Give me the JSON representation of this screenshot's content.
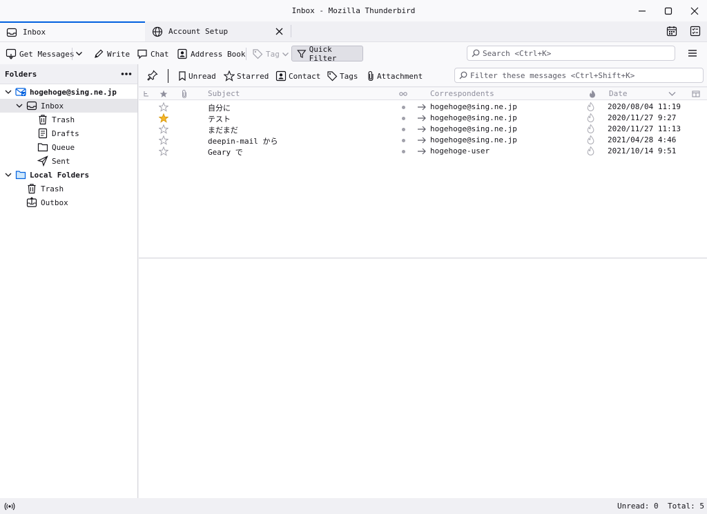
{
  "window": {
    "title": "Inbox - Mozilla Thunderbird"
  },
  "tabs": [
    {
      "label": "Inbox"
    },
    {
      "label": "Account Setup"
    }
  ],
  "toolbar": {
    "get_messages": "Get Messages",
    "write": "Write",
    "chat": "Chat",
    "address_book": "Address Book",
    "tag": "Tag",
    "quick_filter": "Quick Filter",
    "search_placeholder": "Search <Ctrl+K>"
  },
  "folders": {
    "header": "Folders",
    "account": "hogehoge@sing.ne.jp",
    "items": [
      "Inbox",
      "Trash",
      "Drafts",
      "Queue",
      "Sent"
    ],
    "local_folders": "Local Folders",
    "local_items": [
      "Trash",
      "Outbox"
    ]
  },
  "quickfilter": {
    "unread": "Unread",
    "starred": "Starred",
    "contact": "Contact",
    "tags": "Tags",
    "attachment": "Attachment",
    "filter_placeholder": "Filter these messages <Ctrl+Shift+K>"
  },
  "columns": {
    "subject": "Subject",
    "correspondents": "Correspondents",
    "date": "Date"
  },
  "messages": [
    {
      "subject": "自分に",
      "correspondent": "hogehoge@sing.ne.jp",
      "date": "2020/08/04 11:19",
      "starred": false
    },
    {
      "subject": "テスト",
      "correspondent": "hogehoge@sing.ne.jp",
      "date": "2020/11/27 9:27",
      "starred": true
    },
    {
      "subject": "まだまだ",
      "correspondent": "hogehoge@sing.ne.jp",
      "date": "2020/11/27 11:13",
      "starred": false
    },
    {
      "subject": "deepin-mail から",
      "correspondent": "hogehoge@sing.ne.jp",
      "date": "2021/04/28 4:46",
      "starred": false
    },
    {
      "subject": "Geary で",
      "correspondent": "hogehoge-user",
      "date": "2021/10/14 9:51",
      "starred": false
    }
  ],
  "status": {
    "unread": "Unread: 0",
    "total": "Total: 5"
  },
  "colors": {
    "accent": "#0060df",
    "star": "#f5b629",
    "selected_row": "#e6e6ea"
  }
}
